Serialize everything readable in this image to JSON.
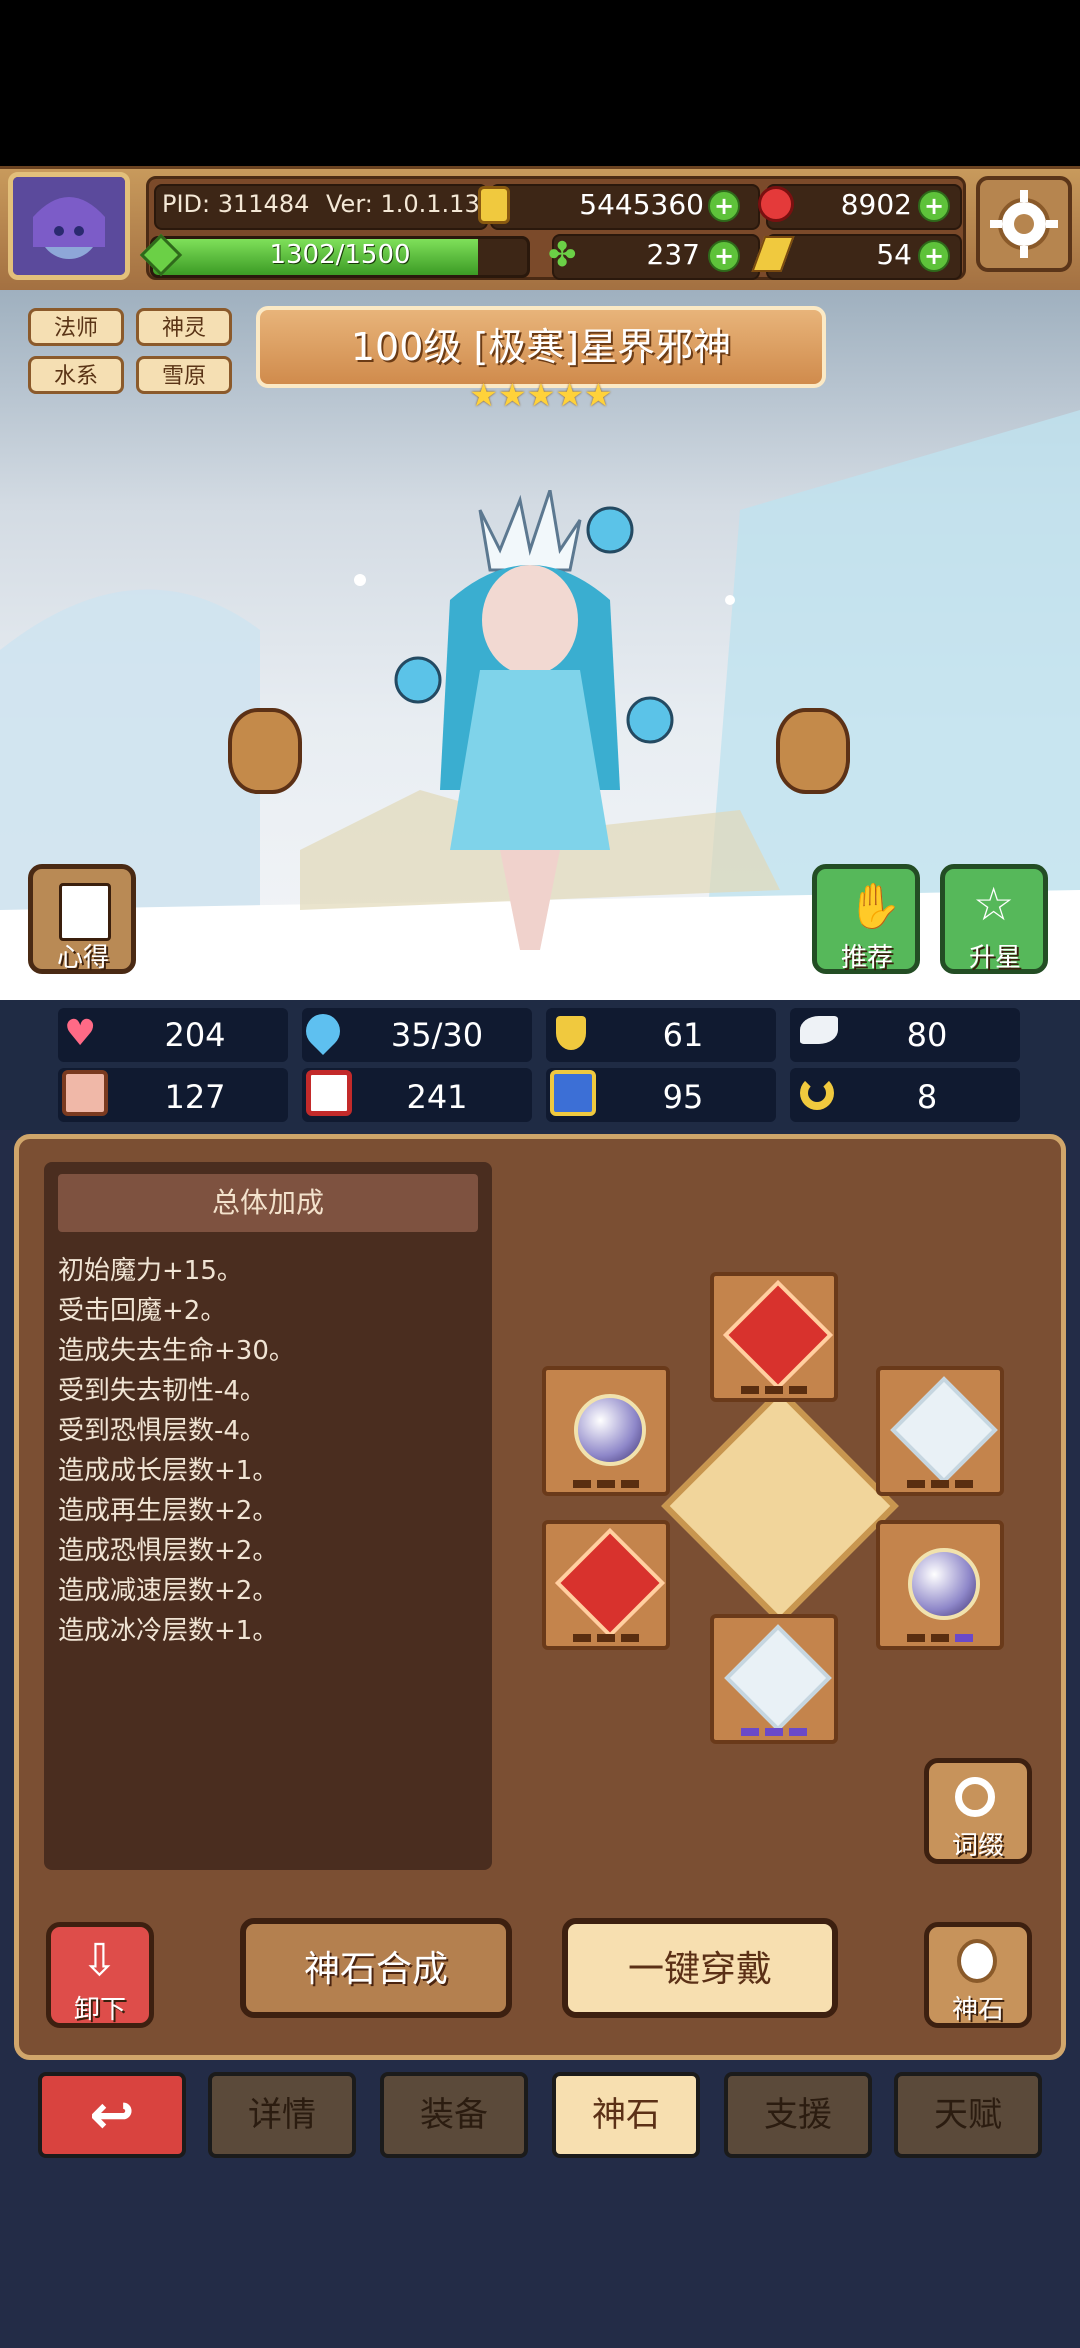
{
  "header": {
    "pid": "PID: 311484",
    "version": "Ver: 1.0.1.13",
    "gold": "5445360",
    "ruby": "8902",
    "exp_bar": "1302/1500",
    "exp_progress": 0.868,
    "clover": "237",
    "hammer": "54"
  },
  "tags": [
    "法师",
    "神灵",
    "水系",
    "雪原"
  ],
  "character": {
    "title": "100级 [极寒]星界邪神",
    "stars": 5
  },
  "buttons": {
    "insight": "心得",
    "recommend": "推荐",
    "star_up": "升星",
    "affix": "词缀",
    "unequip": "卸下",
    "god_stone": "神石",
    "synthesize": "神石合成",
    "equip_all": "一键穿戴"
  },
  "stats": [
    {
      "icon": "heart-icon",
      "value": "204"
    },
    {
      "icon": "mana-drop-icon",
      "value": "35/30"
    },
    {
      "icon": "shield-icon",
      "value": "61"
    },
    {
      "icon": "wing-icon",
      "value": "80"
    },
    {
      "icon": "fist-icon",
      "value": "127"
    },
    {
      "icon": "book-icon",
      "value": "241"
    },
    {
      "icon": "scroll-icon",
      "value": "95"
    },
    {
      "icon": "horseshoe-icon",
      "value": "8"
    }
  ],
  "bonus": {
    "title": "总体加成",
    "lines": [
      "初始魔力+15。",
      "受击回魔+2。",
      "造成失去生命+30。",
      "受到失去韧性-4。",
      "受到恐惧层数-4。",
      "造成成长层数+1。",
      "造成再生层数+2。",
      "造成恐惧层数+2。",
      "造成减速层数+2。",
      "造成冰冷层数+1。"
    ]
  },
  "tabs": {
    "details": "详情",
    "equipment": "装备",
    "god_stone": "神石",
    "support": "支援",
    "talent": "天赋"
  },
  "colors": {
    "accent_green": "#5ec23a",
    "panel_brown": "#7b4f33",
    "tab_active": "#f7dfb0",
    "back_red": "#d9433f"
  }
}
